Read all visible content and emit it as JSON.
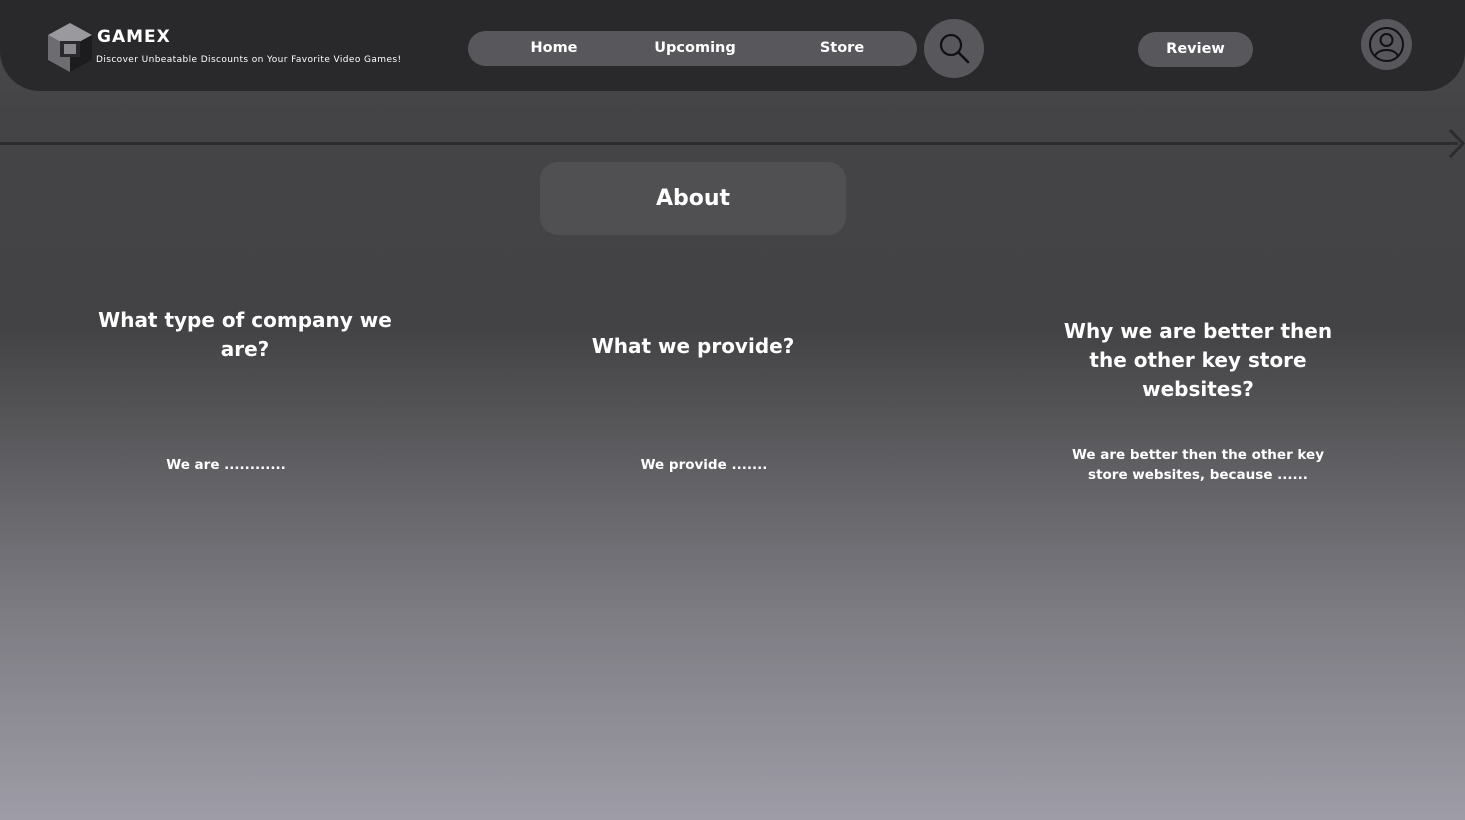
{
  "header": {
    "brand": "GAMEX",
    "tagline": "Discover Unbeatable Discounts on Your Favorite Video Games!",
    "nav": {
      "home": "Home",
      "upcoming": "Upcoming",
      "store": "Store"
    },
    "review_label": "Review",
    "icons": {
      "logo": "cube-logo-icon",
      "search": "search-icon",
      "avatar": "user-circle-icon",
      "next": "chevron-right-icon"
    }
  },
  "about": {
    "title": "About",
    "columns": [
      {
        "heading": "What type of company we are?",
        "body": "We are ............"
      },
      {
        "heading": "What we provide?",
        "body": "We provide ......."
      },
      {
        "heading": "Why we are better then the other key store websites?",
        "body": "We are better then the other key store websites,  because ......"
      }
    ]
  },
  "colors": {
    "header_bg": "#29292b",
    "pill_bg": "#58575b",
    "about_box_bg": "#505052",
    "text": "#ffffff"
  }
}
